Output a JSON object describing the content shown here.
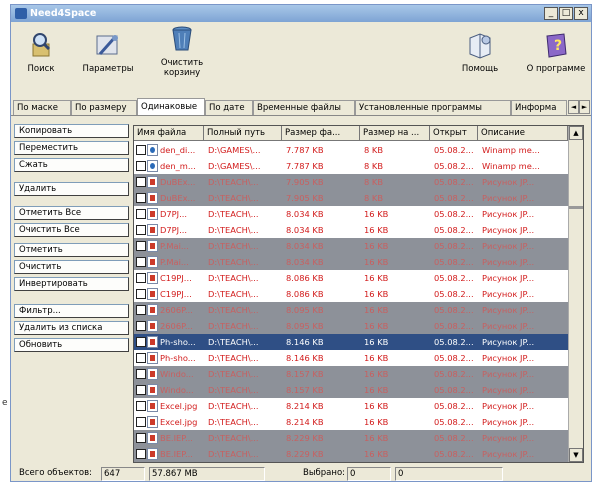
{
  "stray_text": "e",
  "window": {
    "title": "Need4Space"
  },
  "title_buttons": [
    "_",
    "□",
    "x"
  ],
  "toolbar": {
    "search": "Поиск",
    "params": "Параметры",
    "clear_bin_1": "Очистить",
    "clear_bin_2": "корзину",
    "help": "Помощь",
    "about": "О программе"
  },
  "tabs": [
    "По маске",
    "По размеру",
    "Одинаковые",
    "По дате",
    "Временные файлы",
    "Установленные программы",
    "Информа"
  ],
  "tab_arrows": [
    "◄",
    "►"
  ],
  "actions": [
    "Копировать",
    "Переместить",
    "Сжать",
    "Удалить",
    "Отметить Все",
    "Очистить Все",
    "Отметить",
    "Очистить",
    "Инвертировать",
    "Фильтр...",
    "Удалить из списка",
    "Обновить"
  ],
  "columns": [
    "Имя файла",
    "Полный путь",
    "Размер фа...",
    "Размер на ...",
    "Открыт",
    "Описание"
  ],
  "rows": [
    {
      "name": "den_di...",
      "path": "D:\\GAMES\\...",
      "size": "7.787 KB",
      "disk": "8 KB",
      "opened": "05.08.2...",
      "desc": "Winamp me...",
      "style": "white",
      "icon": "exe"
    },
    {
      "name": "den_m...",
      "path": "D:\\GAMES\\...",
      "size": "7.787 KB",
      "disk": "8 KB",
      "opened": "05.08.2...",
      "desc": "Winamp me...",
      "style": "white",
      "icon": "exe"
    },
    {
      "name": "DuBEx...",
      "path": "D:\\TEACH\\...",
      "size": "7.905 KB",
      "disk": "8 KB",
      "opened": "05.08.2...",
      "desc": "Рисунок JP...",
      "style": "gray",
      "icon": "img"
    },
    {
      "name": "DuBEx...",
      "path": "D:\\TEACH\\...",
      "size": "7.905 KB",
      "disk": "8 KB",
      "opened": "05.08.2...",
      "desc": "Рисунок JP...",
      "style": "gray",
      "icon": "img"
    },
    {
      "name": "D7PJ...",
      "path": "D:\\TEACH\\...",
      "size": "8.034 KB",
      "disk": "16 KB",
      "opened": "05.08.2...",
      "desc": "Рисунок JP...",
      "style": "white",
      "icon": "img"
    },
    {
      "name": "D7PJ...",
      "path": "D:\\TEACH\\...",
      "size": "8.034 KB",
      "disk": "16 KB",
      "opened": "05.08.2...",
      "desc": "Рисунок JP...",
      "style": "white",
      "icon": "img"
    },
    {
      "name": "P.Mai...",
      "path": "D:\\TEACH\\...",
      "size": "8.034 KB",
      "disk": "16 KB",
      "opened": "05.08.2...",
      "desc": "Рисунок JP...",
      "style": "gray",
      "icon": "img"
    },
    {
      "name": "P.Mai...",
      "path": "D:\\TEACH\\...",
      "size": "8.034 KB",
      "disk": "16 KB",
      "opened": "05.08.2...",
      "desc": "Рисунок JP...",
      "style": "gray",
      "icon": "img"
    },
    {
      "name": "C19PJ...",
      "path": "D:\\TEACH\\...",
      "size": "8.086 KB",
      "disk": "16 KB",
      "opened": "05.08.2...",
      "desc": "Рисунок JP...",
      "style": "white",
      "icon": "img"
    },
    {
      "name": "C19PJ...",
      "path": "D:\\TEACH\\...",
      "size": "8.086 KB",
      "disk": "16 KB",
      "opened": "05.08.2...",
      "desc": "Рисунок JP...",
      "style": "white",
      "icon": "img"
    },
    {
      "name": "2606P...",
      "path": "D:\\TEACH\\...",
      "size": "8.095 KB",
      "disk": "16 KB",
      "opened": "05.08.2...",
      "desc": "Рисунок JP...",
      "style": "gray",
      "icon": "img"
    },
    {
      "name": "2606P...",
      "path": "D:\\TEACH\\...",
      "size": "8.095 KB",
      "disk": "16 KB",
      "opened": "05.08.2...",
      "desc": "Рисунок JP...",
      "style": "gray",
      "icon": "img"
    },
    {
      "name": "Ph-sho...",
      "path": "D:\\TEACH\\...",
      "size": "8.146 KB",
      "disk": "16 KB",
      "opened": "05.08.2...",
      "desc": "Рисунок JP...",
      "style": "sel",
      "icon": "img"
    },
    {
      "name": "Ph-sho...",
      "path": "D:\\TEACH\\...",
      "size": "8.146 KB",
      "disk": "16 KB",
      "opened": "05.08.2...",
      "desc": "Рисунок JP...",
      "style": "white",
      "icon": "img"
    },
    {
      "name": "Windo...",
      "path": "D:\\TEACH\\...",
      "size": "8.157 KB",
      "disk": "16 KB",
      "opened": "05.08.2...",
      "desc": "Рисунок JP...",
      "style": "gray",
      "icon": "img"
    },
    {
      "name": "Windo...",
      "path": "D:\\TEACH\\...",
      "size": "8.157 KB",
      "disk": "16 KB",
      "opened": "05.08.2...",
      "desc": "Рисунок JP...",
      "style": "gray",
      "icon": "img"
    },
    {
      "name": "Excel.jpg",
      "path": "D:\\TEACH\\...",
      "size": "8.214 KB",
      "disk": "16 KB",
      "opened": "05.08.2...",
      "desc": "Рисунок JP...",
      "style": "white",
      "icon": "img"
    },
    {
      "name": "Excel.jpg",
      "path": "D:\\TEACH\\...",
      "size": "8.214 KB",
      "disk": "16 KB",
      "opened": "05.08.2...",
      "desc": "Рисунок JP...",
      "style": "white",
      "icon": "img"
    },
    {
      "name": "BE.IEP...",
      "path": "D:\\TEACH\\...",
      "size": "8.229 KB",
      "disk": "16 KB",
      "opened": "05.08.2...",
      "desc": "Рисунок JP...",
      "style": "gray",
      "icon": "img"
    },
    {
      "name": "BE.IEP...",
      "path": "D:\\TEACH\\...",
      "size": "8.229 KB",
      "disk": "16 KB",
      "opened": "05.08.2...",
      "desc": "Рисунок JP...",
      "style": "gray",
      "icon": "img"
    }
  ],
  "scroll_arrows": [
    "▲",
    "▼"
  ],
  "status": {
    "total_label": "Всего объектов:",
    "total_count": "647",
    "total_size": "57.867 MB",
    "selected_label": "Выбрано:",
    "selected_count": "0",
    "selected_size": "0"
  },
  "colors": {
    "row_white": "#ffffff",
    "row_gray": "#8d9199",
    "row_selected": "#2f4f85",
    "text_red": "#d21b1b"
  }
}
